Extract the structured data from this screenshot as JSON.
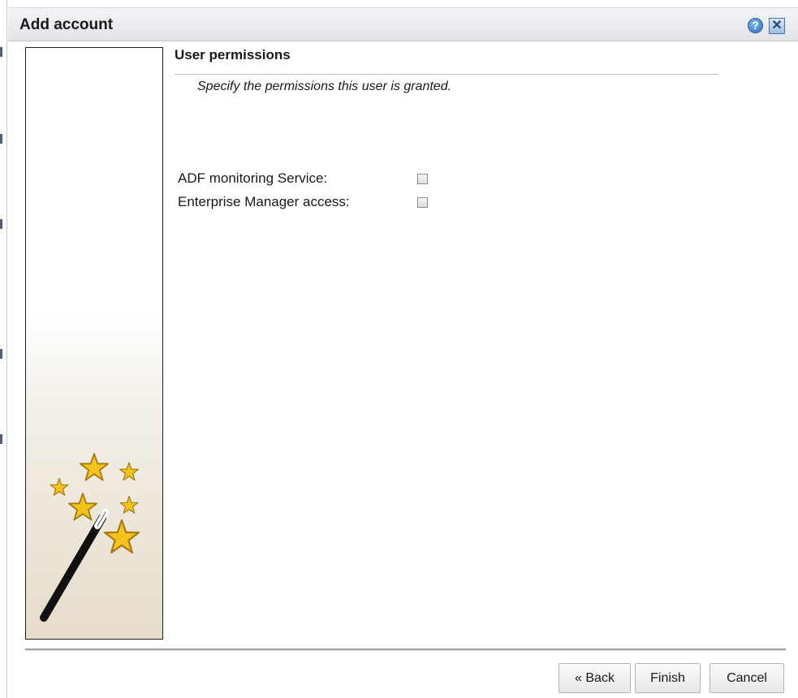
{
  "window": {
    "title": "Add account",
    "help_glyph": "?",
    "close_glyph": "✕"
  },
  "section": {
    "title": "User permissions",
    "description": "Specify the permissions this user is granted."
  },
  "permissions": [
    {
      "label": "ADF monitoring Service:",
      "checked": false
    },
    {
      "label": "Enterprise Manager access:",
      "checked": false
    }
  ],
  "buttons": {
    "back": "« Back",
    "finish": "Finish",
    "cancel": "Cancel"
  },
  "icons": {
    "wizard_graphic": "magic-wand-with-stars"
  },
  "colors": {
    "star_fill": "#f5c21b",
    "star_outline": "#a67a12",
    "wand": "#111111"
  }
}
